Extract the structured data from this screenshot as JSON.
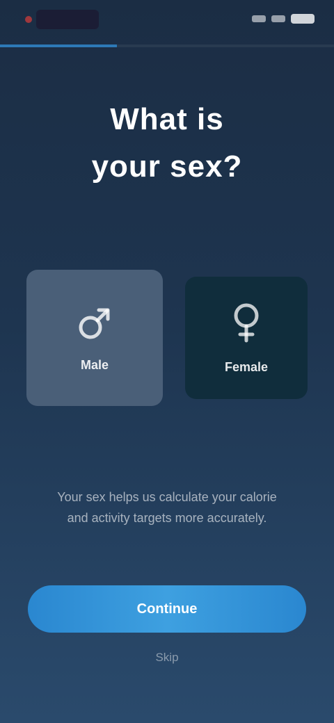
{
  "progress": {
    "fraction": 0.35
  },
  "header": {
    "title_line1": "What is",
    "title_line2": "your sex?"
  },
  "options": [
    {
      "label": "Male",
      "icon": "male-symbol-icon",
      "selected": true
    },
    {
      "label": "Female",
      "icon": "female-symbol-icon",
      "selected": false
    }
  ],
  "description": "Your sex helps us calculate your calorie and activity targets more accurately.",
  "actions": {
    "continue_label": "Continue",
    "skip_label": "Skip"
  },
  "colors": {
    "accent": "#2f8fd8",
    "selected_card": "#4a5f78",
    "unselected_card": "#102d3c"
  }
}
